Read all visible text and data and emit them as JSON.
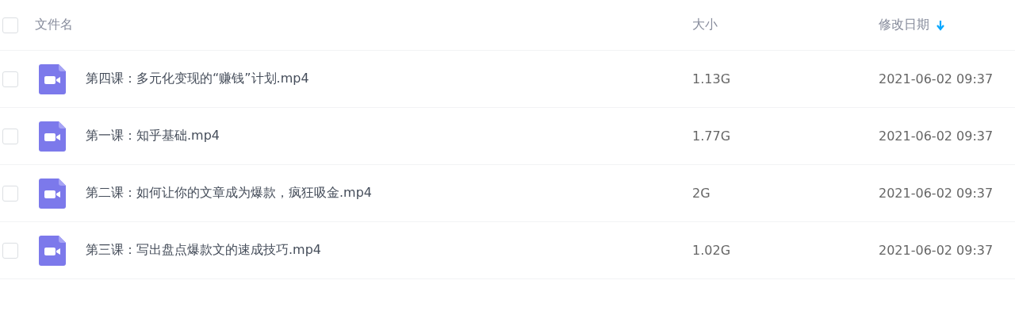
{
  "table": {
    "select_all": {
      "checked": false
    },
    "columns": [
      {
        "label": "文件名",
        "sorted": false
      },
      {
        "label": "大小",
        "sorted": false
      },
      {
        "label": "修改日期",
        "sorted": true
      }
    ],
    "rows": [
      {
        "checked": false,
        "kind": "video",
        "name": "第四课：多元化变现的“赚钱”计划.mp4",
        "size": "1.13G",
        "modified": "2021-06-02 09:37"
      },
      {
        "checked": false,
        "kind": "video",
        "name": "第一课：知乎基础.mp4",
        "size": "1.77G",
        "modified": "2021-06-02 09:37"
      },
      {
        "checked": false,
        "kind": "video",
        "name": "第二课：如何让你的文章成为爆款，疯狂吸金.mp4",
        "size": "2G",
        "modified": "2021-06-02 09:37"
      },
      {
        "checked": false,
        "kind": "video",
        "name": "第三课：写出盘点爆款文的速成技巧.mp4",
        "size": "1.02G",
        "modified": "2021-06-02 09:37"
      }
    ]
  }
}
